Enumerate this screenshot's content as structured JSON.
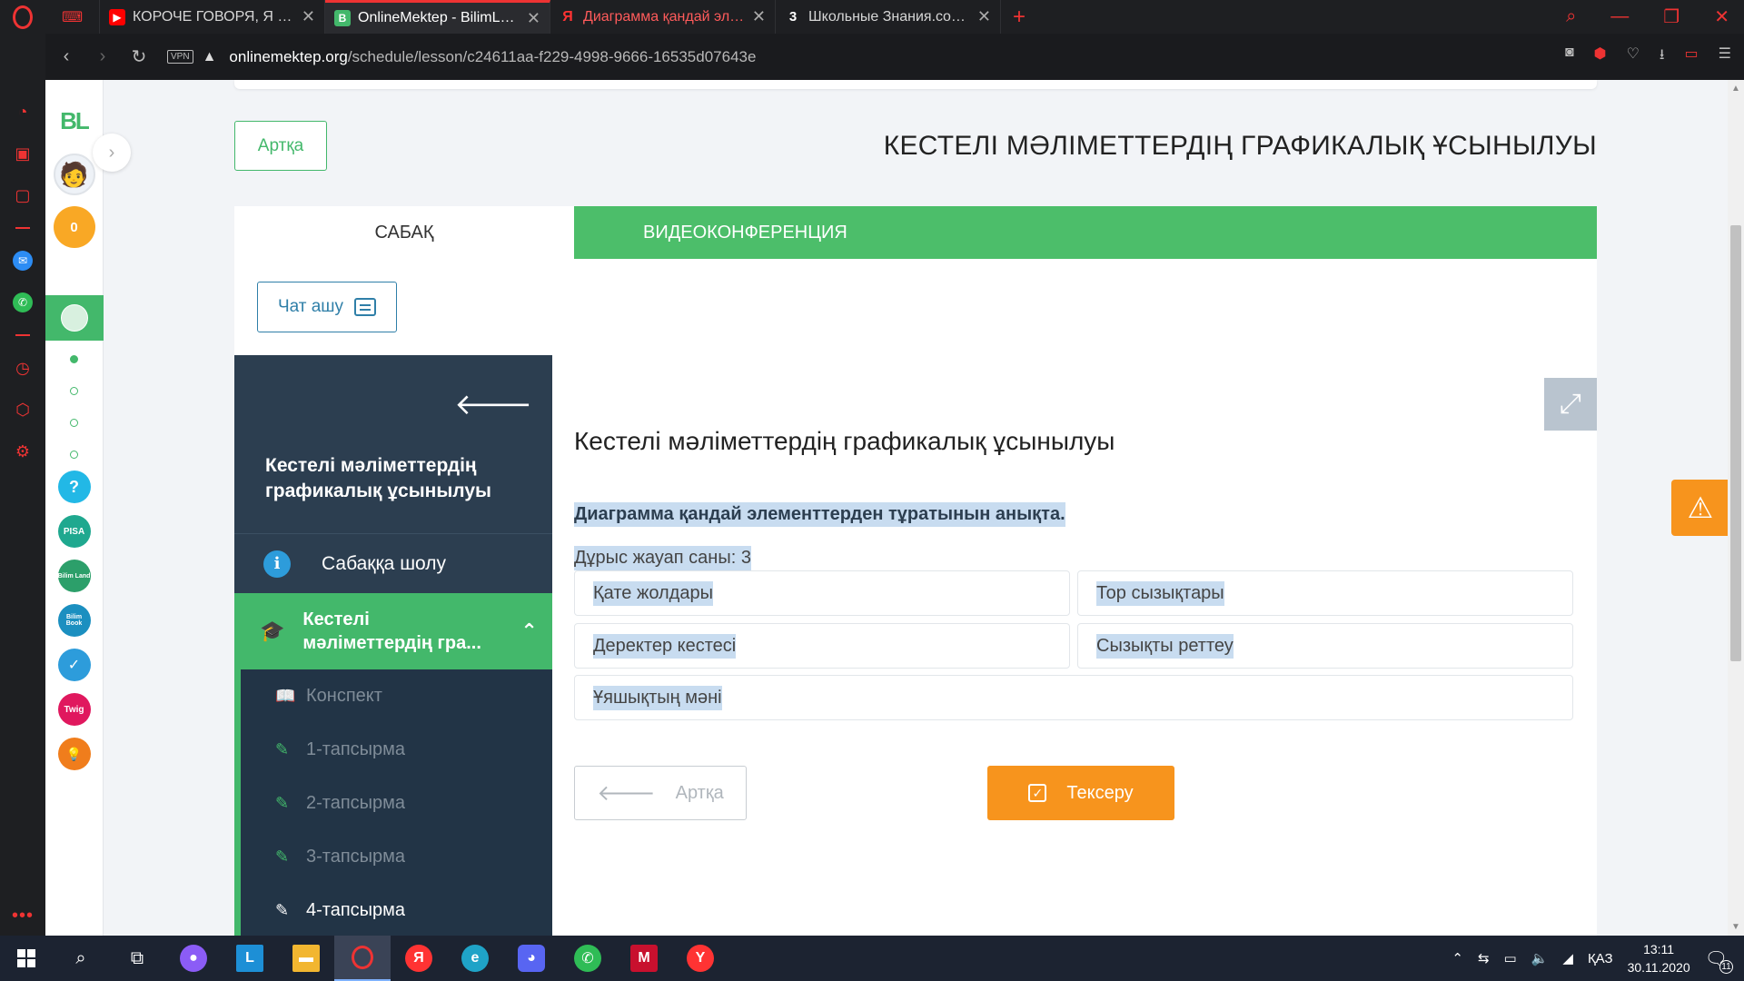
{
  "browser": {
    "tabs": [
      {
        "title": "КОРОЧЕ ГОВОРЯ, Я КОПИ",
        "icon": "youtube-icon",
        "color": "#ff0000"
      },
      {
        "title": "OnlineMektep - BilimLand",
        "icon": "bilimland-icon",
        "color": "#43b86b",
        "active": true
      },
      {
        "title": "Диаграмма қандай элеме",
        "icon": "yandex-icon",
        "color": "#ff3333"
      },
      {
        "title": "Школьные Знания.com - Р",
        "icon": "znania-icon",
        "color": "#ffffff"
      }
    ],
    "new_tab_glyph": "+",
    "vpn_label": "VPN",
    "url_domain": "onlinemektep.org",
    "url_path": "/schedule/lesson/c24611aa-f229-4998-9666-16535d07643e"
  },
  "rail": {
    "logo": "BL",
    "coins": "0",
    "apps": [
      {
        "label": "?",
        "color": "#22b8e6",
        "icon": "help-icon"
      },
      {
        "label": "PISA",
        "color": "#1fa88f",
        "icon": "pisa-icon"
      },
      {
        "label": "Bilim Land",
        "color": "#2c9f6a",
        "icon": "bilimland-app-icon"
      },
      {
        "label": "Bilim Book",
        "color": "#1b8fc0",
        "icon": "bilimbook-icon"
      },
      {
        "label": "✓",
        "color": "#2d9cdb",
        "icon": "check-app-icon"
      },
      {
        "label": "Twig",
        "color": "#e0185e",
        "icon": "twig-icon"
      },
      {
        "label": "💡",
        "color": "#f07d1c",
        "icon": "idea-app-icon"
      }
    ]
  },
  "header": {
    "back_label": "Артқа",
    "title": "КЕСТЕЛІ МӘЛІМЕТТЕРДІҢ ГРАФИКАЛЫҚ ҰСЫНЫЛУЫ"
  },
  "tabs": {
    "lesson": "САБАҚ",
    "video": "ВИДЕОКОНФЕРЕНЦИЯ"
  },
  "chat": {
    "label": "Чат ашу"
  },
  "nav": {
    "title": "Кестелі мәліметтердің графикалық ұсынылуы",
    "overview": "Сабаққа шолу",
    "section": "Кестелі мәліметтердің гра...",
    "items": [
      {
        "label": "Конспект",
        "icon": "book-icon"
      },
      {
        "label": "1-тапсырма",
        "icon": "edit-icon"
      },
      {
        "label": "2-тапсырма",
        "icon": "edit-icon"
      },
      {
        "label": "3-тапсырма",
        "icon": "edit-icon"
      },
      {
        "label": "4-тапсырма",
        "icon": "edit-icon",
        "current": true
      }
    ]
  },
  "exercise": {
    "heading": "Кестелі мәліметтердің графикалық ұсынылуы",
    "question": "Диаграмма қандай элементтерден тұратынын анықта.",
    "correct_count": "Дұрыс жауап саны: 3",
    "options": [
      "Қате жолдары",
      "Тор сызықтары",
      "Деректер кестесі",
      "Сызықты реттеу",
      "Ұяшықтың мәні"
    ],
    "back_label": "Артқа",
    "check_label": "Тексеру"
  },
  "taskbar": {
    "language": "ҚАЗ",
    "time": "13:11",
    "date": "30.11.2020",
    "notifications": "11"
  },
  "colors": {
    "green": "#43b86b",
    "orange": "#f7941d",
    "navy": "#2c3e50",
    "opera_red": "#ee3333"
  }
}
